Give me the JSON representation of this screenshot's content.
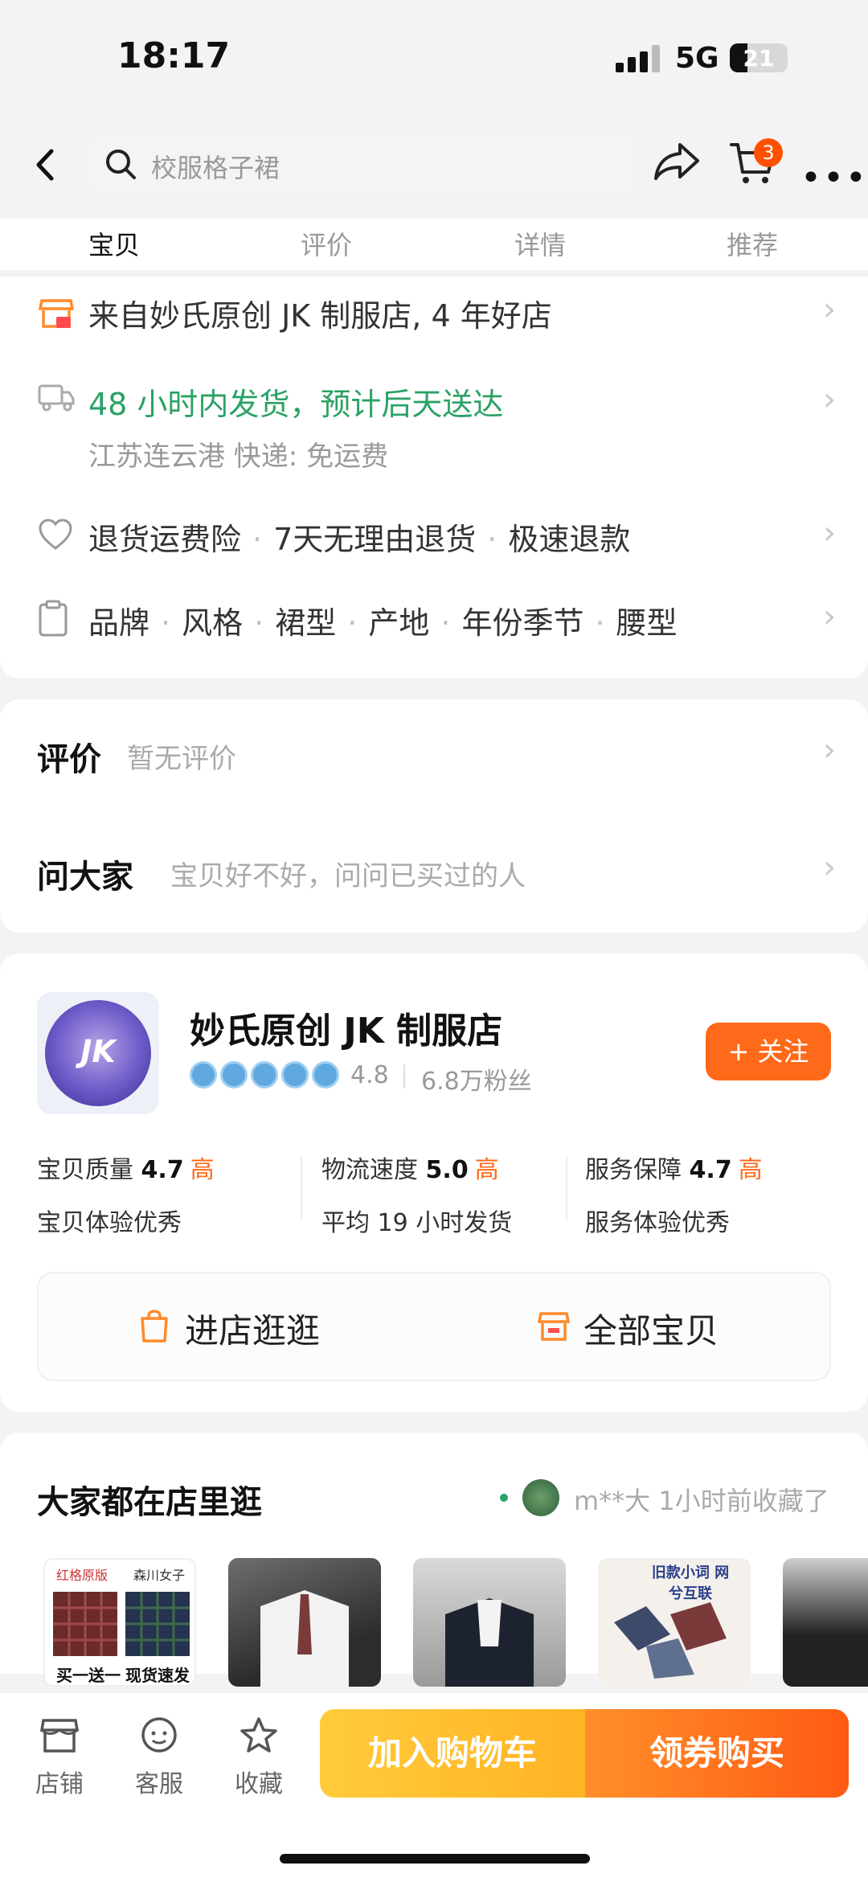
{
  "status_bar": {
    "time": "18:17",
    "network": "5G",
    "battery": "21"
  },
  "header": {
    "search_placeholder": "校服格子裙",
    "cart_count": "3",
    "tabs": [
      {
        "label": "宝贝",
        "active": true
      },
      {
        "label": "评价",
        "active": false
      },
      {
        "label": "详情",
        "active": false
      },
      {
        "label": "推荐",
        "active": false
      }
    ]
  },
  "info": {
    "shop_from": "来自妙氏原创 JK 制服店, 4 年好店",
    "shipping": "48 小时内发货，预计后天送达",
    "shipping_detail": "江苏连云港  快递: 免运费",
    "services": [
      "退货运费险",
      "7天无理由退货",
      "极速退款"
    ],
    "params": [
      "品牌",
      "风格",
      "裙型",
      "产地",
      "年份季节",
      "腰型"
    ]
  },
  "reviews": {
    "title": "评价",
    "subtitle": "暂无评价",
    "qa_title": "问大家",
    "qa_subtitle": "宝贝好不好，问问已买过的人"
  },
  "shop": {
    "name": "妙氏原创 JK 制服店",
    "rating": "4.8",
    "fans": "6.8万粉丝",
    "medal_count": 5,
    "follow_label": "+ 关注",
    "metrics": [
      {
        "label": "宝贝质量",
        "score": "4.7",
        "level": "高",
        "desc": "宝贝体验优秀"
      },
      {
        "label": "物流速度",
        "score": "5.0",
        "level": "高",
        "desc": "平均 19 小时发货"
      },
      {
        "label": "服务保障",
        "score": "4.7",
        "level": "高",
        "desc": "服务体验优秀"
      }
    ],
    "enter_shop": "进店逛逛",
    "all_items": "全部宝贝"
  },
  "browse": {
    "title": "大家都在店里逛",
    "activity": "m**大 1小时前收藏了",
    "thumb1": {
      "tag_left": "红格原版",
      "tag_right": "森川女子",
      "caption_left": "买一送一",
      "caption_right": "现货速发"
    },
    "thumb4_text": "旧款小词 网兮互联"
  },
  "bottom_bar": {
    "store": "店铺",
    "service": "客服",
    "favorite": "收藏",
    "add_to_cart": "加入购物车",
    "buy": "领券购买"
  },
  "colors": {
    "accent": "#ff5a12",
    "green": "#2aa265",
    "yellow": "#ffbf2e"
  }
}
